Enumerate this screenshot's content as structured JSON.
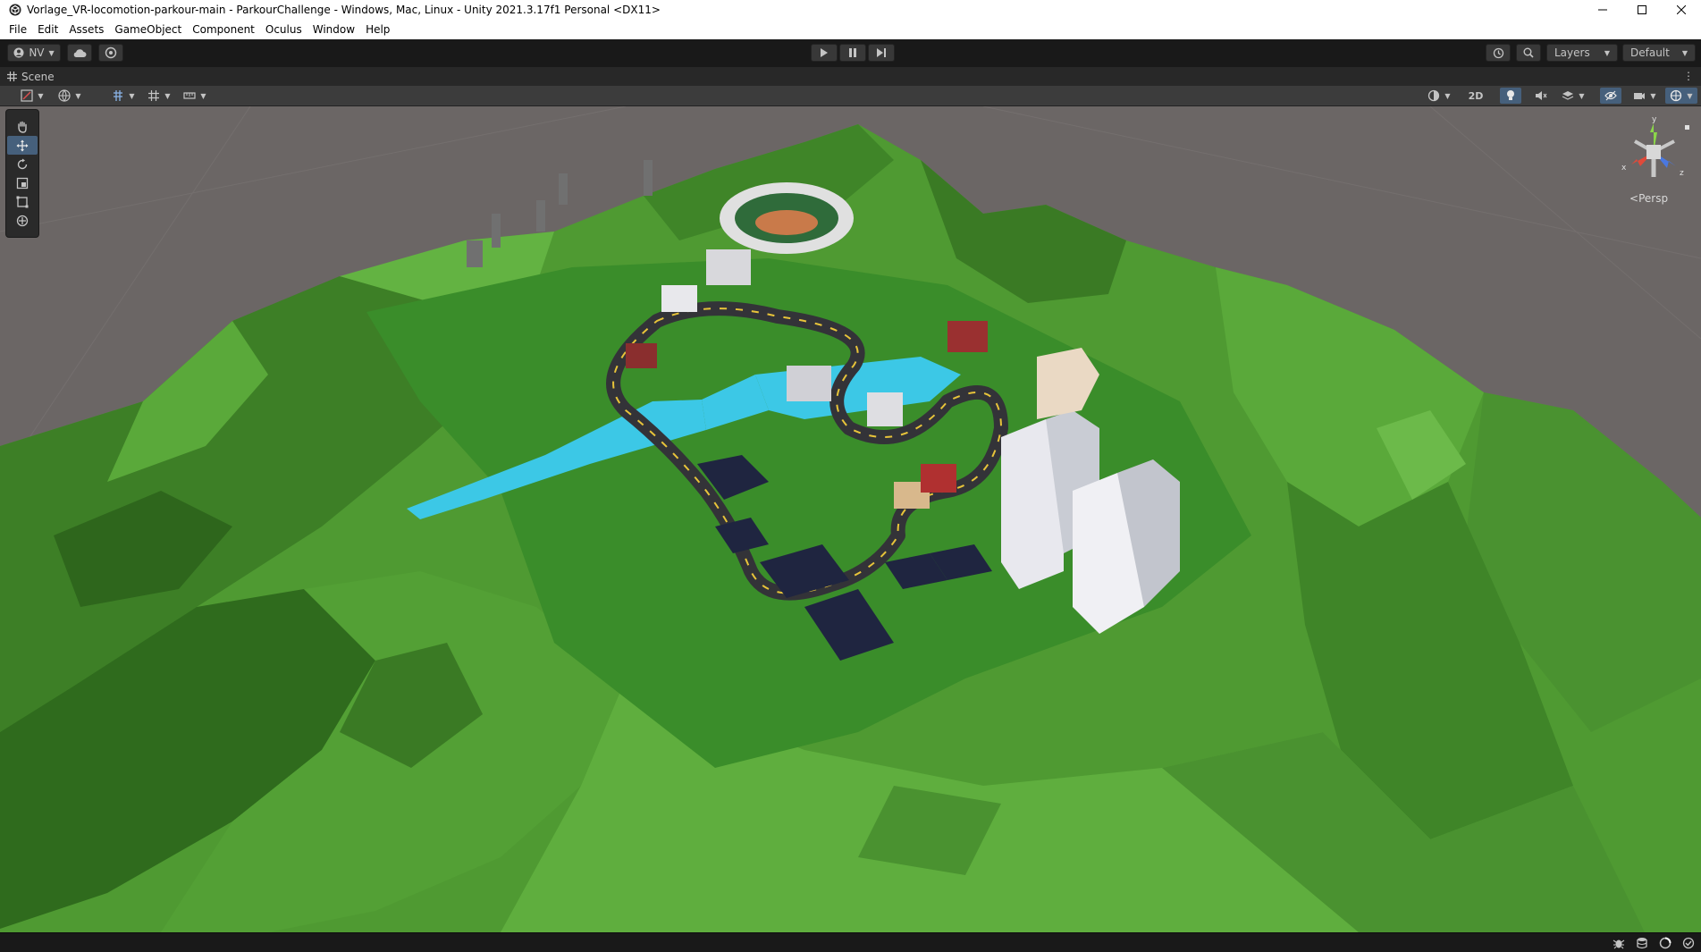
{
  "window": {
    "title": "Vorlage_VR-locomotion-parkour-main - ParkourChallenge - Windows, Mac, Linux - Unity 2021.3.17f1 Personal <DX11>"
  },
  "menu": {
    "items": [
      "File",
      "Edit",
      "Assets",
      "GameObject",
      "Component",
      "Oculus",
      "Window",
      "Help"
    ]
  },
  "toolbar": {
    "account_label": "NV",
    "layers_label": "Layers",
    "layout_label": "Default"
  },
  "scene_tab": {
    "label": "Scene"
  },
  "scene_toolbar": {
    "mode_2d_label": "2D"
  },
  "gizmo": {
    "y_label": "y",
    "x_label": "x",
    "z_label": "z",
    "projection_label": "Persp"
  },
  "colors": {
    "accent": "#46607c",
    "terrain_green": "#4a9a2f",
    "water": "#3cc8e6",
    "road": "#333338",
    "viewport_bg": "#6b6665"
  }
}
